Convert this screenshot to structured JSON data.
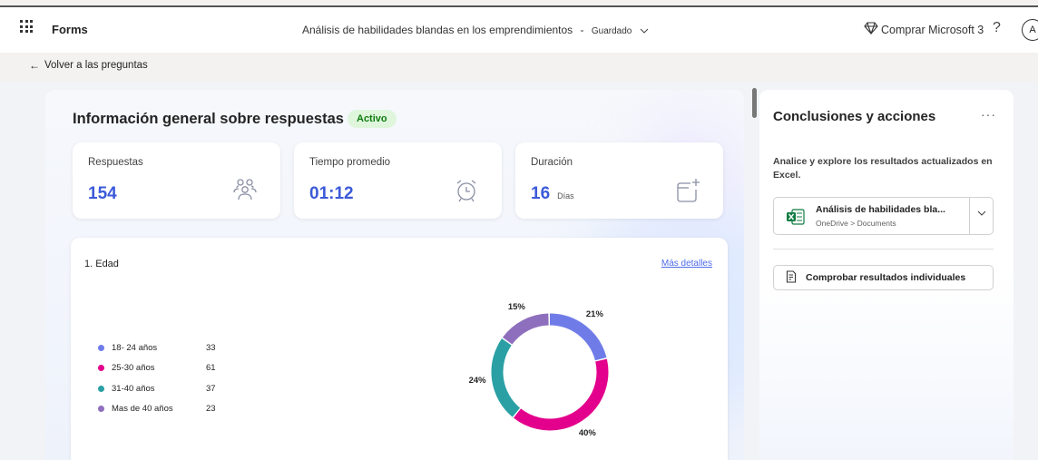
{
  "header": {
    "app_name": "Forms",
    "doc_title": "Análisis de habilidades blandas en los emprendimientos",
    "separator": "-",
    "save_status": "Guardado",
    "buy_label": "Comprar Microsoft 3",
    "help_label": "?",
    "avatar_initial": "A"
  },
  "nav": {
    "back_label": "Volver a las preguntas"
  },
  "overview": {
    "title": "Información general sobre respuestas",
    "status_badge": "Activo",
    "stats": [
      {
        "label": "Respuestas",
        "value": "154",
        "icon": "people-icon"
      },
      {
        "label": "Tiempo promedio",
        "value": "01:12",
        "icon": "alarm-clock-icon"
      },
      {
        "label": "Duración",
        "value": "16",
        "unit": "Días",
        "icon": "calendar-sparkle-icon"
      }
    ]
  },
  "question": {
    "title": "1. Edad",
    "more_link": "Más detalles"
  },
  "chart_data": {
    "type": "pie",
    "categories": [
      "18- 24 años",
      "25-30 años",
      "31-40 años",
      "Mas de 40 años"
    ],
    "values": [
      33,
      61,
      37,
      23
    ],
    "percent_labels": [
      "21%",
      "40%",
      "24%",
      "15%"
    ],
    "colors": [
      "#6f7ce8",
      "#e3008c",
      "#2aa0a4",
      "#8e6fbd"
    ],
    "title": "1. Edad",
    "legend_position": "left",
    "donut": true
  },
  "side": {
    "title": "Conclusiones y acciones",
    "more_label": "···",
    "description": "Analice y explore los resultados actualizados en Excel.",
    "file_name": "Análisis de habilidades bla...",
    "file_path": "OneDrive > Documents",
    "check_button": "Comprobar resultados individuales"
  }
}
